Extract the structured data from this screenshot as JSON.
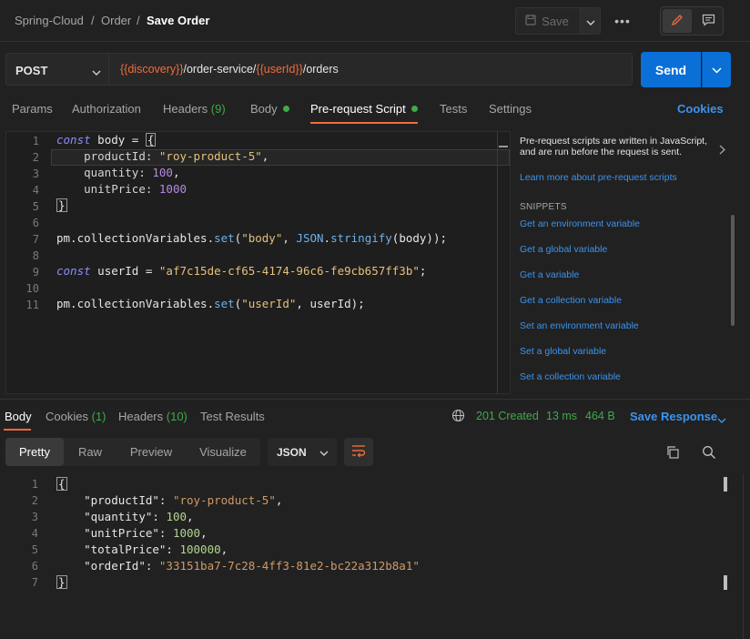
{
  "breadcrumb": {
    "workspace": "Spring-Cloud",
    "folder": "Order",
    "request": "Save Order",
    "sep": "/"
  },
  "toolbar": {
    "save_label": "Save",
    "more_label": "•••"
  },
  "request": {
    "method": "POST",
    "url_parts": [
      {
        "text": "{{discovery}}",
        "kind": "var"
      },
      {
        "text": "/order-service/",
        "kind": "plain"
      },
      {
        "text": "{{userId}}",
        "kind": "var"
      },
      {
        "text": "/orders",
        "kind": "plain"
      }
    ],
    "send_label": "Send"
  },
  "req_tabs": {
    "params": "Params",
    "authorization": "Authorization",
    "headers": "Headers",
    "headers_count": "(9)",
    "body": "Body",
    "prerequest": "Pre-request Script",
    "tests": "Tests",
    "settings": "Settings",
    "cookies": "Cookies"
  },
  "editor": {
    "line_numbers": [
      "1",
      "2",
      "3",
      "4",
      "5",
      "6",
      "7",
      "8",
      "9",
      "10",
      "11"
    ],
    "l1_kw": "const",
    "l1_rest": " body = ",
    "l1_brace": "{",
    "l2_prop": "productId: ",
    "l2_str": "\"roy-product-5\"",
    "l2_end": ",",
    "l3_prop": "quantity: ",
    "l3_num": "100",
    "l3_end": ",",
    "l4_prop": "unitPrice: ",
    "l4_num": "1000",
    "l5_brace": "}",
    "l7_a": "pm.collectionVariables.",
    "l7_fn": "set",
    "l7_b": "(",
    "l7_str": "\"body\"",
    "l7_c": ", ",
    "l7_json": "JSON",
    "l7_d": ".",
    "l7_fn2": "stringify",
    "l7_e": "(body));",
    "l9_kw": "const",
    "l9_rest": " userId = ",
    "l9_str": "\"af7c15de-cf65-4174-96c6-fe9cb657ff3b\"",
    "l9_end": ";",
    "l11_a": "pm.collectionVariables.",
    "l11_fn": "set",
    "l11_b": "(",
    "l11_str": "\"userId\"",
    "l11_c": ", userId);"
  },
  "side_panel": {
    "description": "Pre-request scripts are written in JavaScript, and are run before the request is sent.",
    "learn_link": "Learn more about pre-request scripts",
    "snippets_title": "SNIPPETS",
    "snippets": [
      "Get an environment variable",
      "Get a global variable",
      "Get a variable",
      "Get a collection variable",
      "Set an environment variable",
      "Set a global variable",
      "Set a collection variable"
    ]
  },
  "response": {
    "tabs": {
      "body": "Body",
      "cookies": "Cookies",
      "cookies_count": "(1)",
      "headers": "Headers",
      "headers_count": "(10)",
      "test_results": "Test Results"
    },
    "status": "201 Created",
    "time": "13 ms",
    "size": "464 B",
    "save_response": "Save Response",
    "views": [
      "Pretty",
      "Raw",
      "Preview",
      "Visualize"
    ],
    "format": "JSON",
    "line_numbers": [
      "1",
      "2",
      "3",
      "4",
      "5",
      "6",
      "7"
    ],
    "open_brace": "{",
    "close_brace": "}",
    "fields": [
      {
        "key": "\"productId\"",
        "value": "\"roy-product-5\"",
        "vtype": "str",
        "comma": ","
      },
      {
        "key": "\"quantity\"",
        "value": "100",
        "vtype": "num",
        "comma": ","
      },
      {
        "key": "\"unitPrice\"",
        "value": "1000",
        "vtype": "num",
        "comma": ","
      },
      {
        "key": "\"totalPrice\"",
        "value": "100000",
        "vtype": "num",
        "comma": ","
      },
      {
        "key": "\"orderId\"",
        "value": "\"33151ba7-7c28-4ff3-81e2-bc22a312b8a1\"",
        "vtype": "str",
        "comma": ""
      }
    ],
    "colon": ": "
  },
  "colors": {
    "accent": "#f26b3a",
    "link": "#3b94f0",
    "success": "#3faa48",
    "send": "#0a6fd6"
  },
  "icons": [
    "save-icon",
    "chevron-down-icon",
    "more-icon",
    "pencil-icon",
    "comment-icon",
    "chevron-right-icon",
    "globe-icon",
    "wrap-lines-icon",
    "copy-icon",
    "search-icon"
  ]
}
